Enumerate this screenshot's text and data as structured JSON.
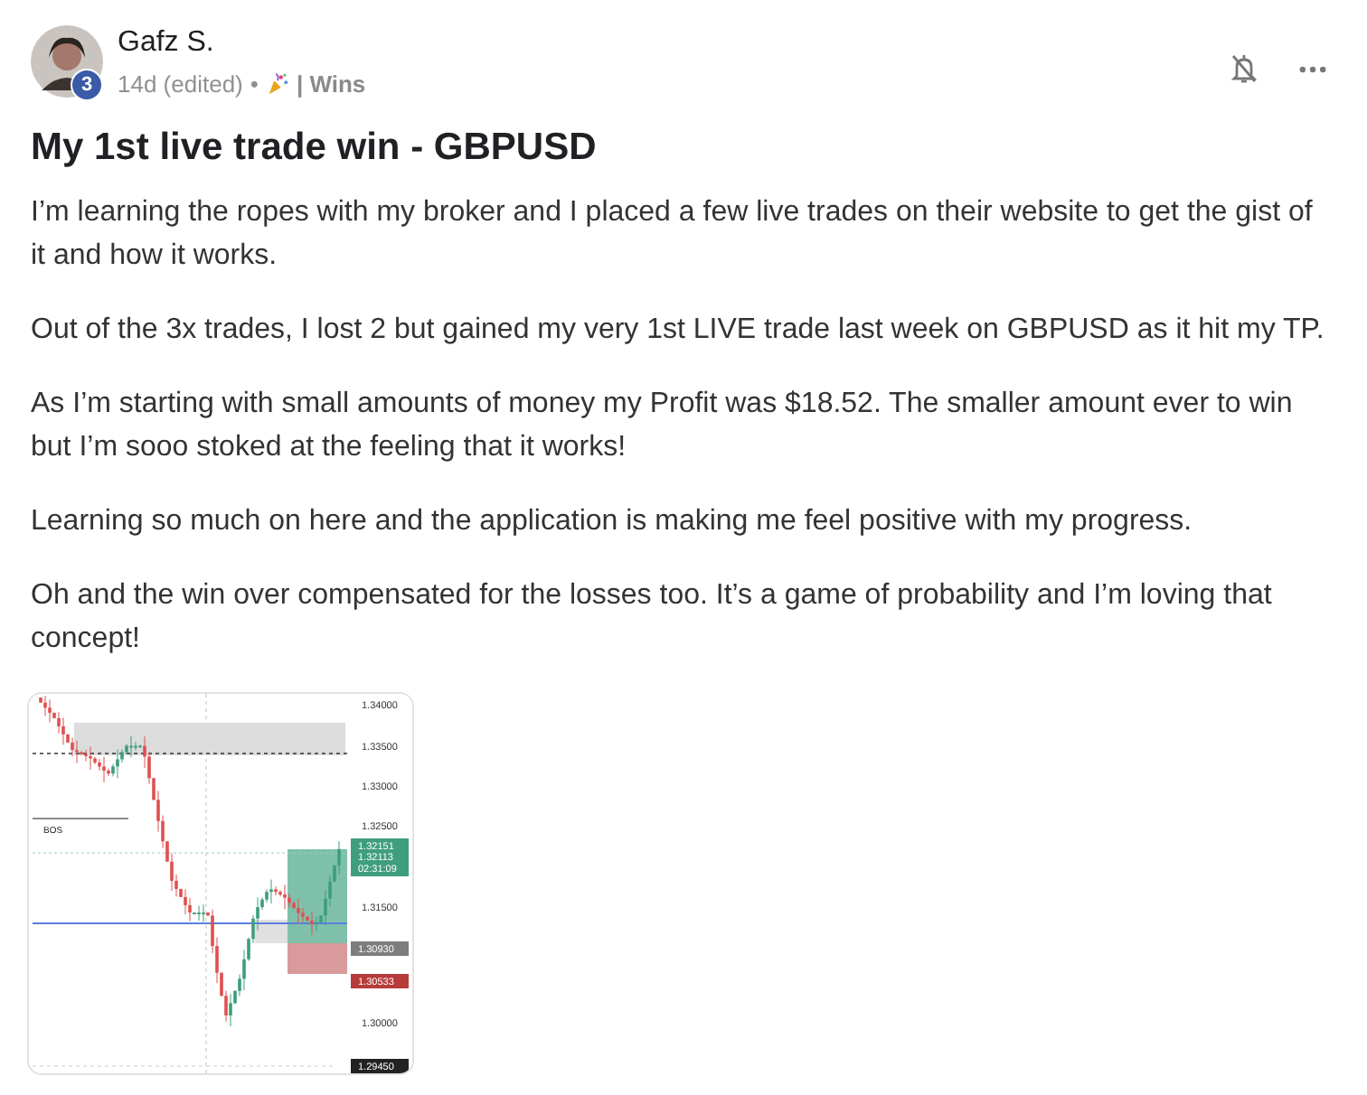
{
  "post": {
    "author": "Gafz S.",
    "level_badge": "3",
    "age": "14d (edited)",
    "separator": "•",
    "category": "| Wins",
    "title": "My 1st live trade win - GBPUSD",
    "paragraphs": [
      "I’m learning the ropes with my broker and I placed a few live trades on their website to get the gist of it and how it works.",
      "Out of the 3x trades, I lost 2 but gained my very 1st LIVE trade last week on GBPUSD as it hit my TP.",
      "As I’m starting with small amounts of money my Profit was $18.52. The smaller amount ever to win but I’m sooo stoked at the feeling that it works!",
      "Learning so much on here and the application is making me feel positive with my progress.",
      "Oh and the win over compensated for the losses too. It’s a game of probability and I’m loving that concept!"
    ],
    "attachment": {
      "marker_label": "BOS",
      "axis_labels": [
        "1.34000",
        "1.33500",
        "1.33000",
        "1.32500",
        "1.31500",
        "1.30000"
      ],
      "price_tags": [
        {
          "kind": "target",
          "lines": [
            "1.32151"
          ]
        },
        {
          "kind": "current",
          "lines": [
            "1.32113",
            "02:31:09"
          ]
        },
        {
          "kind": "entry",
          "lines": [
            "1.30930"
          ]
        },
        {
          "kind": "stop",
          "lines": [
            "1.30533"
          ]
        },
        {
          "kind": "last",
          "lines": [
            "1.29450"
          ]
        }
      ]
    }
  }
}
